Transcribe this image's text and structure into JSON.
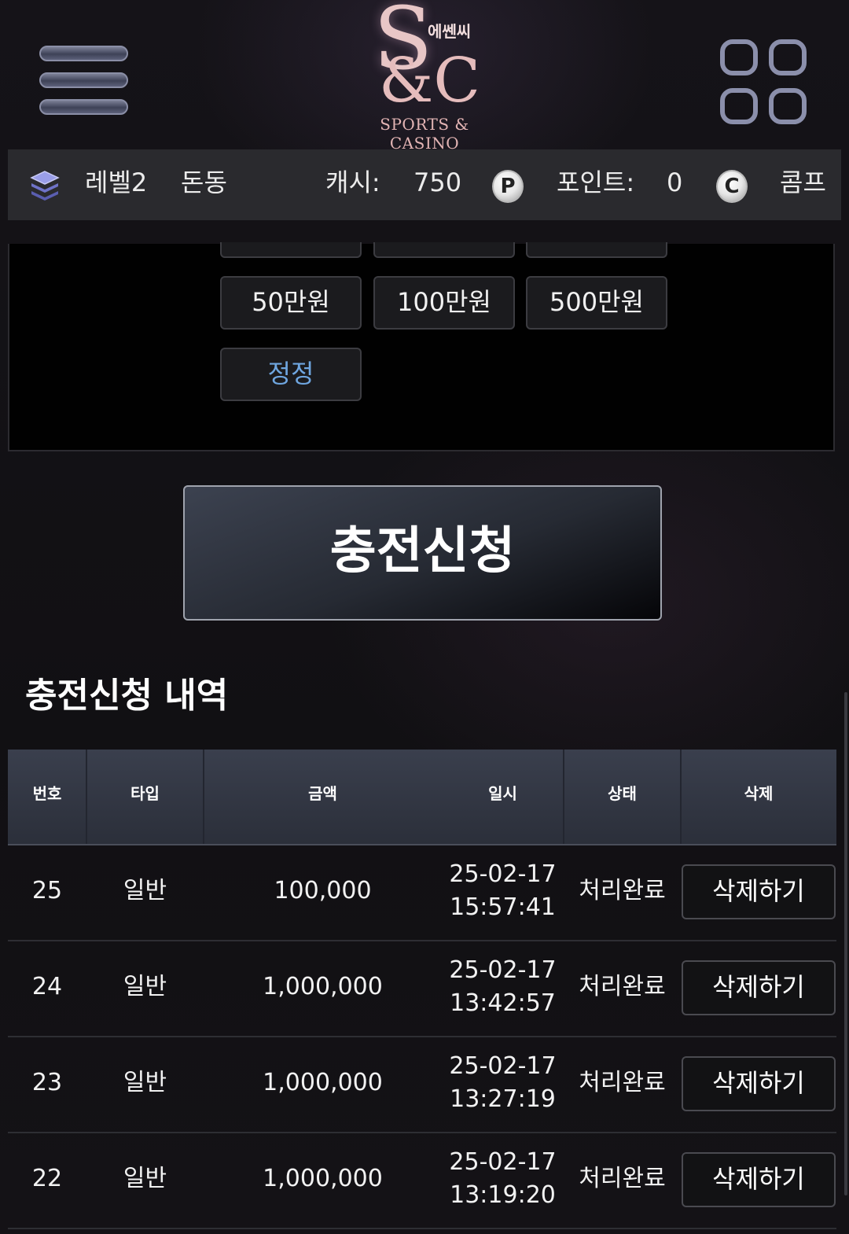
{
  "header": {
    "logo_monogram": "S",
    "logo_amp": "&C",
    "logo_korean": "에쎈씨",
    "logo_subtitle": "SPORTS & CASINO"
  },
  "infobar": {
    "level": "레벨2",
    "username": "돈동",
    "cash_label": "캐시:",
    "cash_value": "750",
    "point_icon": "P",
    "point_label": "포인트:",
    "point_value": "0",
    "comp_icon": "C",
    "comp_label": "콤프"
  },
  "amounts": {
    "row_partial": [
      "",
      "",
      ""
    ],
    "buttons": [
      "50만원",
      "100만원",
      "500만원"
    ],
    "reset_label": "정정"
  },
  "submit_label": "충전신청",
  "history": {
    "title": "충전신청 내역",
    "columns": [
      "번호",
      "타입",
      "금액",
      "일시",
      "상태",
      "삭제"
    ],
    "rows": [
      {
        "no": "25",
        "type": "일반",
        "amount": "100,000",
        "date": "25-02-17",
        "time": "15:57:41",
        "status": "처리완료",
        "action": "삭제하기"
      },
      {
        "no": "24",
        "type": "일반",
        "amount": "1,000,000",
        "date": "25-02-17",
        "time": "13:42:57",
        "status": "처리완료",
        "action": "삭제하기"
      },
      {
        "no": "23",
        "type": "일반",
        "amount": "1,000,000",
        "date": "25-02-17",
        "time": "13:27:19",
        "status": "처리완료",
        "action": "삭제하기"
      },
      {
        "no": "22",
        "type": "일반",
        "amount": "1,000,000",
        "date": "25-02-17",
        "time": "13:19:20",
        "status": "처리완료",
        "action": "삭제하기"
      }
    ]
  },
  "colors": {
    "background": "#121114",
    "infobar": "#2a2a2e",
    "reset_text": "#6fa6e0",
    "logo_pink": "#e5bcbc"
  },
  "icons": [
    "hamburger-menu-icon",
    "app-grid-icon",
    "level-stack-icon",
    "point-coin-icon",
    "comp-coin-icon"
  ]
}
